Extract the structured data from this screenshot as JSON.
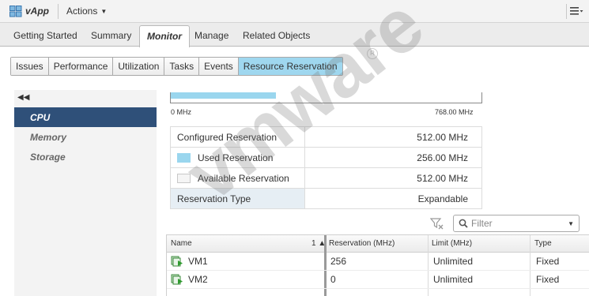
{
  "header": {
    "app_title": "vApp",
    "actions_label": "Actions",
    "icons": {
      "app": "vapp-icon",
      "menu": "menu-icon"
    }
  },
  "main_tabs": [
    {
      "label": "Getting Started",
      "active": false
    },
    {
      "label": "Summary",
      "active": false
    },
    {
      "label": "Monitor",
      "active": true
    },
    {
      "label": "Manage",
      "active": false
    },
    {
      "label": "Related Objects",
      "active": false
    }
  ],
  "sub_tabs": [
    {
      "label": "Issues",
      "active": false
    },
    {
      "label": "Performance",
      "active": false
    },
    {
      "label": "Utilization",
      "active": false
    },
    {
      "label": "Tasks",
      "active": false
    },
    {
      "label": "Events",
      "active": false
    },
    {
      "label": "Resource Reservation",
      "active": true
    }
  ],
  "left_nav": {
    "items": [
      {
        "label": "CPU",
        "active": true
      },
      {
        "label": "Memory",
        "active": false
      },
      {
        "label": "Storage",
        "active": false
      }
    ]
  },
  "reservation_bar": {
    "min_label": "0 MHz",
    "max_label": "768.00 MHz",
    "fill_fraction": 0.338
  },
  "reservation_table": {
    "rows": [
      {
        "label": "Configured Reservation",
        "value": "512.00 MHz"
      },
      {
        "label": "Used Reservation",
        "value": "256.00 MHz"
      },
      {
        "label": "Available Reservation",
        "value": "512.00 MHz"
      },
      {
        "label": "Reservation Type",
        "value": "Expandable"
      }
    ]
  },
  "filter": {
    "placeholder": "Filter"
  },
  "vm_table": {
    "columns": [
      {
        "label": "Name",
        "sort_indicator": "1 ▲"
      },
      {
        "label": "Reservation (MHz)"
      },
      {
        "label": "Limit (MHz)"
      },
      {
        "label": "Type"
      }
    ],
    "rows": [
      {
        "name": "VM1",
        "reservation": "256",
        "limit": "Unlimited",
        "type": "Fixed"
      },
      {
        "name": "VM2",
        "reservation": "0",
        "limit": "Unlimited",
        "type": "Fixed"
      }
    ]
  },
  "watermark": {
    "text": "vmware",
    "registered": "R"
  },
  "colors": {
    "accent_fill": "#9ad6ee",
    "nav_active": "#2f5079",
    "subtab_active": "#9fd7ef"
  }
}
